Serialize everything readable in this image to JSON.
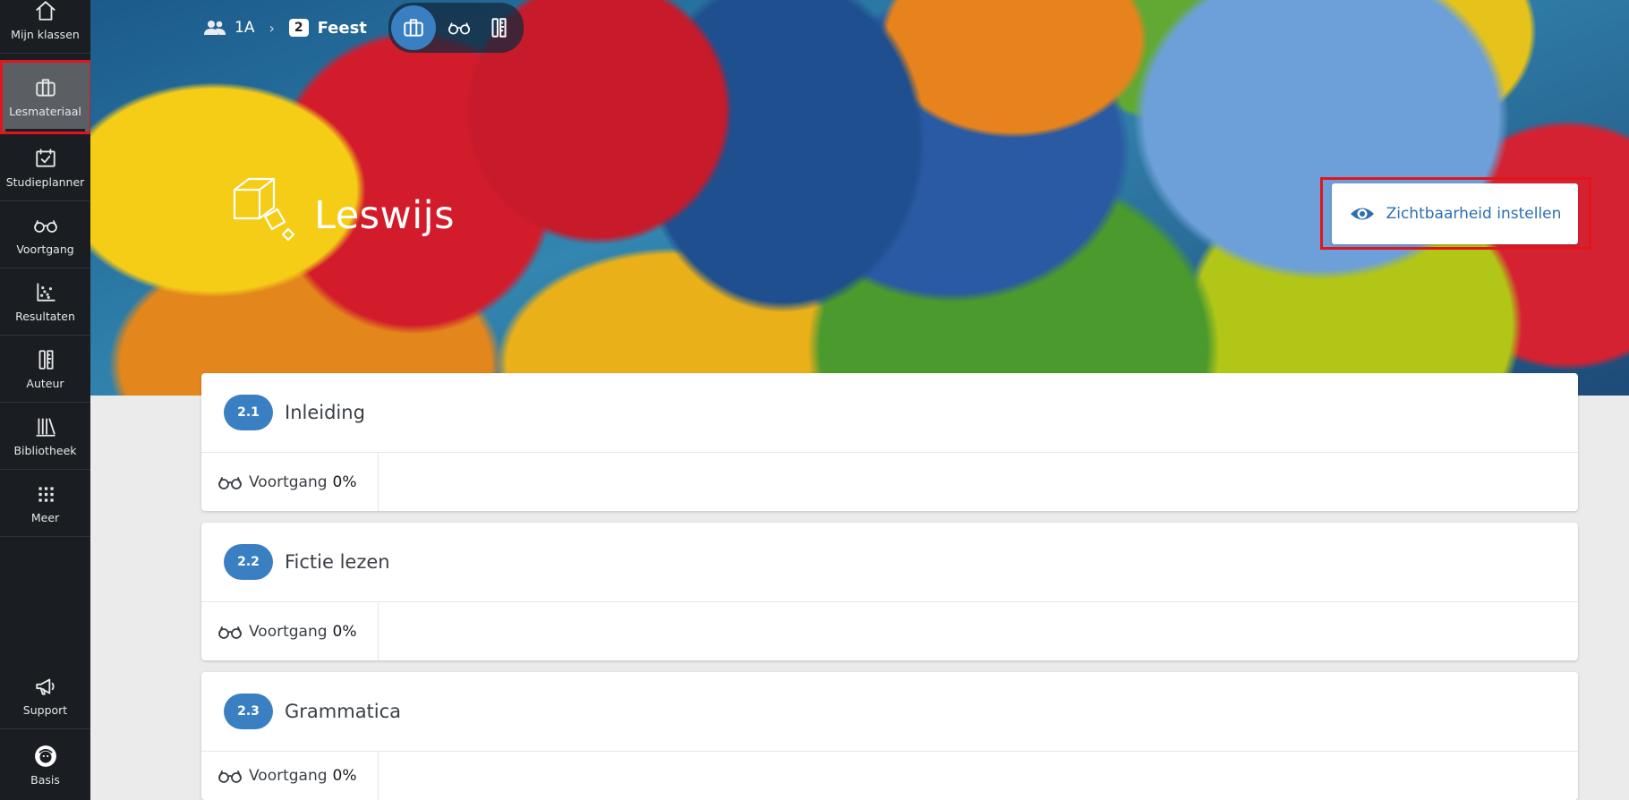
{
  "sidebar": {
    "items": [
      {
        "label": "Mijn klassen",
        "icon": "home-icon"
      },
      {
        "label": "Lesmateriaal",
        "icon": "briefcase-icon",
        "active": true
      },
      {
        "label": "Studieplanner",
        "icon": "calendar-check-icon"
      },
      {
        "label": "Voortgang",
        "icon": "glasses-icon"
      },
      {
        "label": "Resultaten",
        "icon": "scatter-chart-icon"
      },
      {
        "label": "Auteur",
        "icon": "pencil-ruler-icon"
      },
      {
        "label": "Bibliotheek",
        "icon": "library-icon"
      },
      {
        "label": "Meer",
        "icon": "grid-icon"
      }
    ],
    "bottom": [
      {
        "label": "Support",
        "icon": "megaphone-icon"
      },
      {
        "label": "Basis",
        "icon": "avatar-icon"
      }
    ]
  },
  "breadcrumb": {
    "class_label": "1A",
    "chapter_number": "2",
    "chapter_label": "Feest"
  },
  "header": {
    "title": "Leswijs",
    "visibility_button": "Zichtbaarheid instellen"
  },
  "chapters": [
    {
      "number": "2.1",
      "title": "Inleiding",
      "progress_label": "Voortgang",
      "progress_value": "0%"
    },
    {
      "number": "2.2",
      "title": "Fictie lezen",
      "progress_label": "Voortgang",
      "progress_value": "0%"
    },
    {
      "number": "2.3",
      "title": "Grammatica",
      "progress_label": "Voortgang",
      "progress_value": "0%"
    }
  ],
  "colors": {
    "sidebar_bg": "#1a1d21",
    "accent": "#3a7fc1",
    "highlight": "#e3141b"
  }
}
